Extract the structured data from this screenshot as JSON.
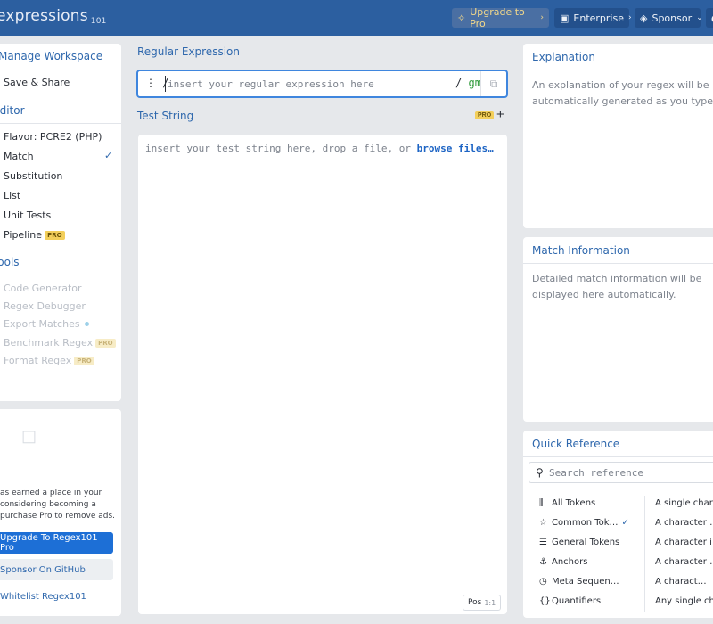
{
  "header": {
    "brand": "expressions",
    "brand_sub": "101",
    "upgrade_label": "Upgrade to Pro",
    "enterprise_label": "Enterprise",
    "sponsor_label": "Sponsor"
  },
  "sidebar": {
    "workspace_title": "Manage Workspace",
    "save_share": "Save & Share",
    "editor_title": "Editor",
    "flavor_prefix": "Flavor:",
    "flavor_value": "PCRE2 (PHP)",
    "items": [
      {
        "label": "Match"
      },
      {
        "label": "Substitution"
      },
      {
        "label": "List"
      },
      {
        "label": "Unit Tests"
      },
      {
        "label": "Pipeline",
        "badge": "PRO"
      }
    ],
    "tools_title": "Tools",
    "tools": [
      {
        "label": "Code Generator"
      },
      {
        "label": "Regex Debugger"
      },
      {
        "label": "Export Matches"
      },
      {
        "label": "Benchmark Regex",
        "badge": "PRO"
      },
      {
        "label": "Format Regex",
        "badge": "PRO"
      }
    ]
  },
  "ad": {
    "text": "as earned a place in your considering becoming a purchase Pro to remove ads.",
    "upgrade_btn": "Upgrade To Regex101 Pro",
    "sponsor_btn": "Sponsor On GitHub",
    "whitelist_btn": "Whitelist Regex101"
  },
  "editor": {
    "regex_title": "Regular Expression",
    "regex_delim": "/",
    "regex_placeholder": "insert your regular expression here",
    "regex_close_delim": "/",
    "flags": "gm",
    "test_title": "Test String",
    "test_badge": "PRO",
    "test_placeholder": "insert your test string here, drop a file, or ",
    "test_link": "browse files…",
    "pos_label": "Pos",
    "pos_value": "1:1"
  },
  "explanation": {
    "title": "Explanation",
    "text": "An explanation of your regex will be automatically generated as you type."
  },
  "match_info": {
    "title": "Match Information",
    "text": "Detailed match information will be displayed here automatically."
  },
  "quick_ref": {
    "title": "Quick Reference",
    "search_placeholder": "Search reference",
    "categories": [
      {
        "label": "All Tokens",
        "icon": "library-icon"
      },
      {
        "label": "Common Tok…",
        "icon": "star-icon"
      },
      {
        "label": "General Tokens",
        "icon": "list-icon"
      },
      {
        "label": "Anchors",
        "icon": "anchor-icon"
      },
      {
        "label": "Meta Sequen…",
        "icon": "clock-icon"
      },
      {
        "label": "Quantifiers",
        "icon": "braces-icon"
      }
    ],
    "descriptions": [
      {
        "text": "A single char…"
      },
      {
        "text": "A character …"
      },
      {
        "text": "A character i…"
      },
      {
        "text": "A character …"
      },
      {
        "text": "A charact…",
        "token": "["
      },
      {
        "text": "Any single cha…"
      }
    ]
  },
  "colors": {
    "topbar": "#2c5fa0",
    "accent": "#2f68ad",
    "pro_badge": "#f3cf5b",
    "flag_green": "#2f9a3a"
  }
}
